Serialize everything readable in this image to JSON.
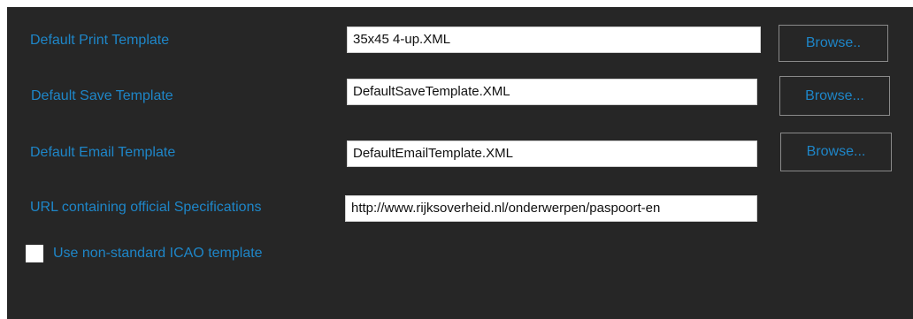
{
  "settings": {
    "print_template": {
      "label": "Default Print Template",
      "value": "35x45 4-up.XML",
      "browse_label": "Browse.."
    },
    "save_template": {
      "label": "Default Save Template",
      "value": "DefaultSaveTemplate.XML",
      "browse_label": "Browse..."
    },
    "email_template": {
      "label": "Default Email Template",
      "value": "DefaultEmailTemplate.XML",
      "browse_label": "Browse..."
    },
    "specifications_url": {
      "label": "URL containing official Specifications",
      "value": "http://www.rijksoverheid.nl/onderwerpen/paspoort-en"
    },
    "non_standard_icao": {
      "label": "Use non-standard ICAO template",
      "checked": false
    }
  },
  "colors": {
    "background": "#262626",
    "label": "#1e86c8",
    "field": "#ffffff",
    "button_border": "#8a8a8a"
  }
}
